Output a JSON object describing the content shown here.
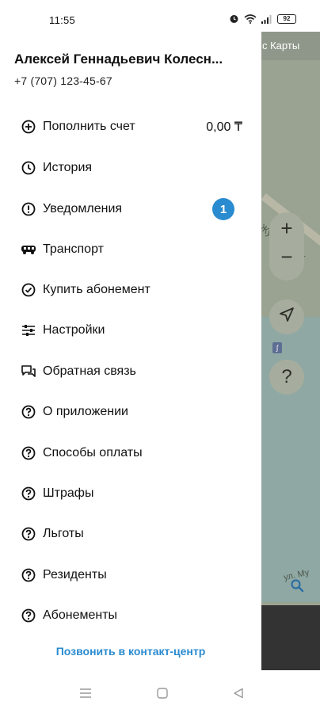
{
  "status_bar": {
    "time": "11:55",
    "battery": "92"
  },
  "map": {
    "title": "с Карты",
    "street_1": "Жумабека Т",
    "street_2": "ул. Му",
    "zoom_in": "+",
    "zoom_out": "−",
    "help": "?",
    "icons": [
      "navigation-arrow-icon",
      "search-icon",
      "small-marker-icon"
    ]
  },
  "drawer": {
    "user_name": "Алексей Геннадьевич Колесн...",
    "user_phone": "+7 (707) 123-45-67",
    "menu": [
      {
        "label": "Пополнить счет",
        "value": "0,00 ₸",
        "icon": "plus-circle-icon"
      },
      {
        "label": "История",
        "icon": "clock-icon"
      },
      {
        "label": "Уведомления",
        "badge": "1",
        "icon": "alert-circle-icon"
      },
      {
        "label": "Транспорт",
        "icon": "bus-icon"
      },
      {
        "label": "Купить абонемент",
        "icon": "check-circle-icon"
      },
      {
        "label": "Настройки",
        "icon": "sliders-icon"
      },
      {
        "label": "Обратная связь",
        "icon": "feedback-icon"
      },
      {
        "label": "О приложении",
        "icon": "help-circle-icon"
      },
      {
        "label": "Способы оплаты",
        "icon": "help-circle-icon"
      },
      {
        "label": "Штрафы",
        "icon": "help-circle-icon"
      },
      {
        "label": "Льготы",
        "icon": "help-circle-icon"
      },
      {
        "label": "Резиденты",
        "icon": "help-circle-icon"
      },
      {
        "label": "Абонементы",
        "icon": "help-circle-icon"
      }
    ],
    "contact_link": "Позвонить в контакт-центр"
  },
  "colors": {
    "accent": "#2a8bd0",
    "map_bg": "#9aa391",
    "map_water": "#8fa8a4",
    "text": "#111111"
  }
}
